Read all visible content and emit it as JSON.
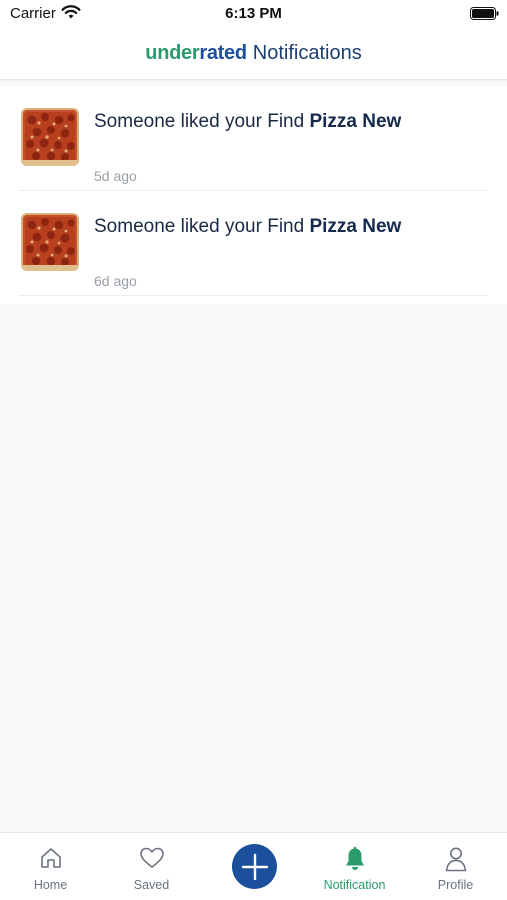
{
  "status_bar": {
    "carrier": "Carrier",
    "time": "6:13 PM"
  },
  "header": {
    "brand_part1": "under",
    "brand_part2": "rated",
    "title": "Notifications",
    "brand_green": "#2a9b6b",
    "brand_blue": "#1c4f9c"
  },
  "notifications": [
    {
      "text": "Someone liked your Find ",
      "item": "Pizza New",
      "time": "5d ago",
      "thumbnail": "pizza-image"
    },
    {
      "text": "Someone liked your Find ",
      "item": "Pizza New",
      "time": "6d ago",
      "thumbnail": "pizza-image"
    }
  ],
  "tab_bar": {
    "home": {
      "label": "Home",
      "icon": "home-icon"
    },
    "saved": {
      "label": "Saved",
      "icon": "heart-icon"
    },
    "add": {
      "icon": "plus-icon"
    },
    "notification": {
      "label": "Notification",
      "icon": "bell-icon",
      "active": true
    },
    "profile": {
      "label": "Profile",
      "icon": "person-icon"
    }
  }
}
